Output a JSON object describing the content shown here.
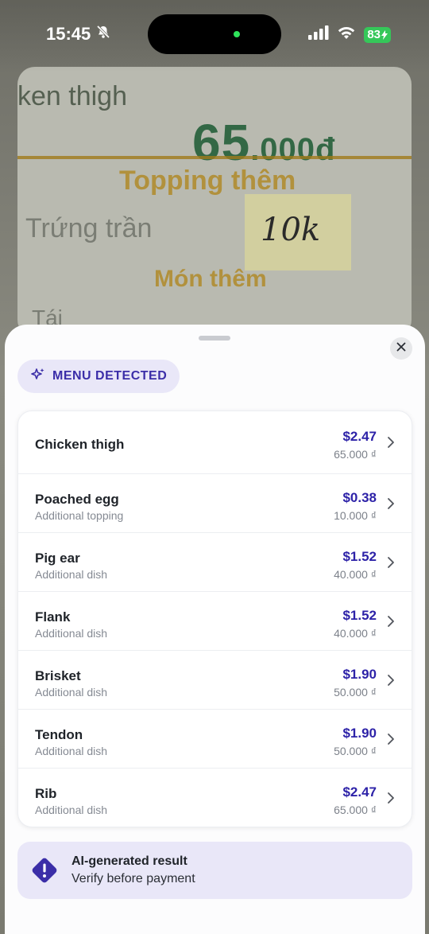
{
  "status": {
    "time": "15:45",
    "battery": "83"
  },
  "background_photo": {
    "title_fragment": "ken thigh",
    "big_price": "65",
    "big_price_suffix": ".000đ",
    "heading_topping": "Topping thêm",
    "item_trung": "Trứng trần",
    "handwritten_price": "10k",
    "heading_mon_them": "Món thêm",
    "item_tai": "Tái"
  },
  "sheet": {
    "badge_label": "MENU DETECTED",
    "items": [
      {
        "name": "Chicken thigh",
        "subtitle": "",
        "usd": "$2.47",
        "vnd": "65.000 ₫"
      },
      {
        "name": "Poached egg",
        "subtitle": "Additional topping",
        "usd": "$0.38",
        "vnd": "10.000 ₫"
      },
      {
        "name": "Pig ear",
        "subtitle": "Additional dish",
        "usd": "$1.52",
        "vnd": "40.000 ₫"
      },
      {
        "name": "Flank",
        "subtitle": "Additional dish",
        "usd": "$1.52",
        "vnd": "40.000 ₫"
      },
      {
        "name": "Brisket",
        "subtitle": "Additional dish",
        "usd": "$1.90",
        "vnd": "50.000 ₫"
      },
      {
        "name": "Tendon",
        "subtitle": "Additional dish",
        "usd": "$1.90",
        "vnd": "50.000 ₫"
      },
      {
        "name": "Rib",
        "subtitle": "Additional dish",
        "usd": "$2.47",
        "vnd": "65.000 ₫"
      }
    ],
    "notice_title": "AI-generated result",
    "notice_body": "Verify before payment"
  },
  "colors": {
    "accent": "#2d22a8",
    "badge_bg": "#e9e7f8",
    "notice_icon": "#3b2ea8"
  },
  "icons": [
    "bell-slash-icon",
    "cellular-signal-icon",
    "wifi-icon",
    "battery-charging-icon",
    "close-icon",
    "sparkles-icon",
    "chevron-right-icon",
    "warning-diamond-icon"
  ]
}
